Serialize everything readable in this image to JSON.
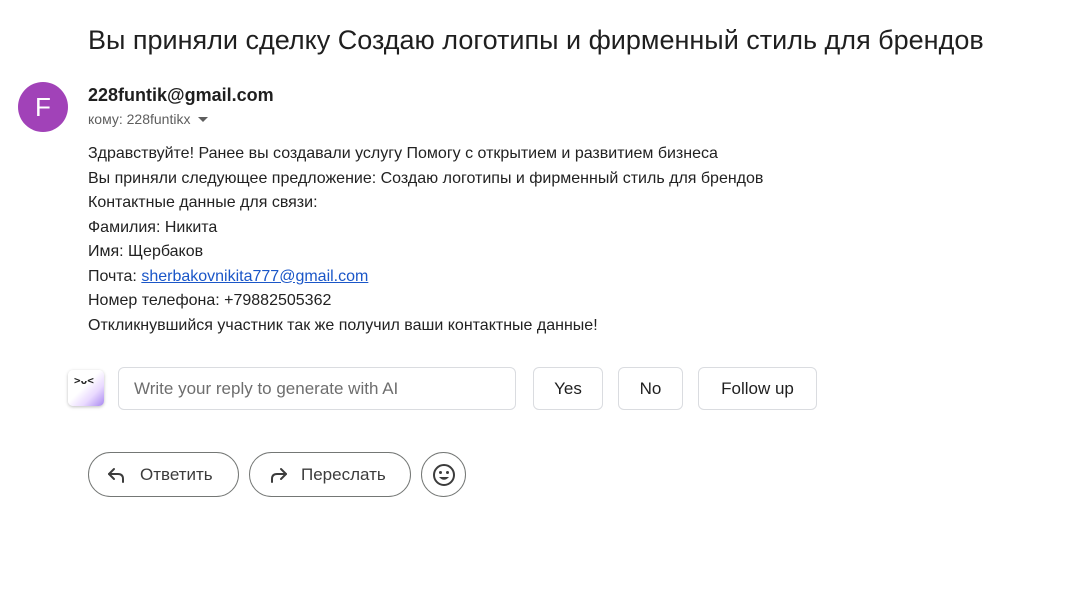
{
  "email": {
    "subject": "Вы приняли сделку Создаю логотипы и фирменный стиль для брендов",
    "sender": {
      "avatar_letter": "F",
      "avatar_color": "#a142b8",
      "address": "228funtik@gmail.com"
    },
    "recipient": "кому: 228funtikx",
    "body": {
      "line1": "Здравствуйте! Ранее вы создавали услугу Помогу с открытием и развитием бизнеса",
      "line2": "Вы приняли следующее предложение: Создаю логотипы и фирменный стиль для брендов",
      "line3": "Контактные данные для связи:",
      "line4": "Фамилия: Никита",
      "line5": "Имя: Щербаков",
      "email_label": "Почта: ",
      "email_link": "sherbakovnikita777@gmail.com",
      "line7": "Номер телефона: +79882505362",
      "line8": "Откликнувшийся участник так же получил ваши контактные данные!"
    }
  },
  "ai_reply": {
    "icon": "gemini-ai-icon",
    "placeholder": "Write your reply to generate with AI",
    "suggestions": {
      "yes": "Yes",
      "no": "No",
      "follow_up": "Follow up"
    }
  },
  "actions": {
    "reply_label": "Ответить",
    "reply_icon": "reply-arrow-icon",
    "forward_label": "Переслать",
    "forward_icon": "forward-arrow-icon",
    "emoji_icon": "smiley-icon"
  },
  "colors": {
    "link": "#1a56c8",
    "border": "#dadce0"
  }
}
